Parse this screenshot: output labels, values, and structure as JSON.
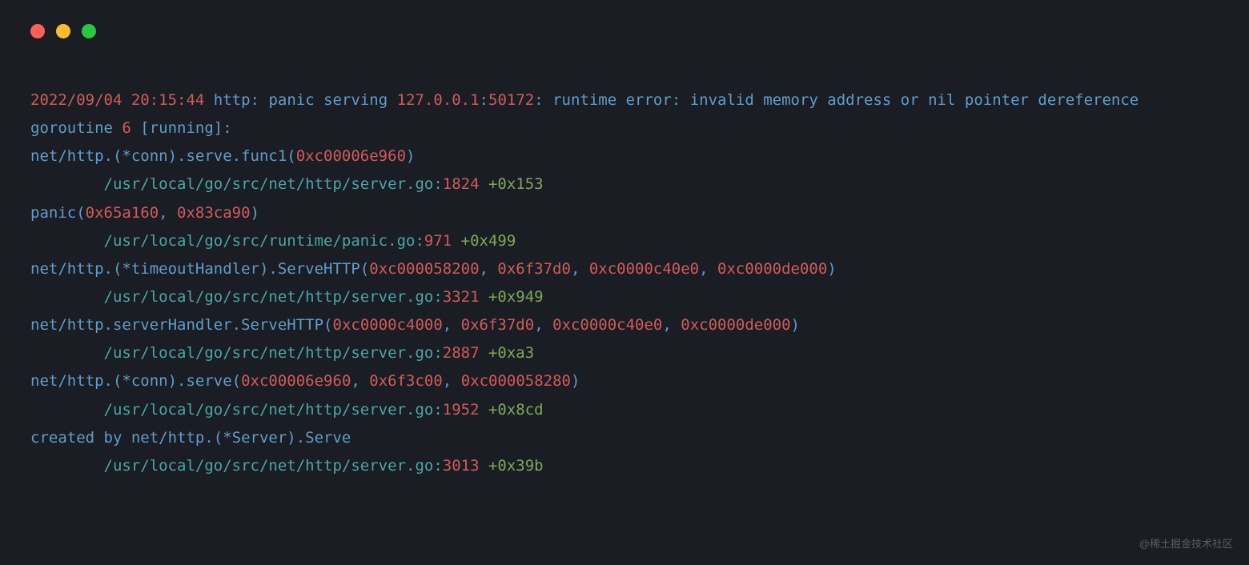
{
  "t": {
    "date": "2022/09/04 20:15:44",
    "http": " http",
    "panic_serving": " panic serving ",
    "ip": "127.0.0.1",
    "port": "50172",
    "runtime_err": " runtime error",
    "invalid": " invalid memory address or nil pointer dereference",
    "gor": "goroutine ",
    "gor_n": "6",
    "running": " [running]",
    "conn_serve_func1": "net/http.(*conn).serve.func1(",
    "hex1": "0xc00006e960",
    "server_go": "        /usr/local/go/src/net/http/server.go:",
    "ln1": "1824",
    "off1": "0x153",
    "panic_open": "panic(",
    "hex2a": "0x65a160",
    "hex2b": "0x83ca90",
    "panic_go": "        /usr/local/go/src/runtime/panic.go:",
    "ln2": "971",
    "off2": "0x499",
    "timeout": "net/http.(*timeoutHandler).ServeHTTP(",
    "hex3a": "0xc000058200",
    "hex3b": "0x6f37d0",
    "hex3c": "0xc0000c40e0",
    "hex3d": "0xc0000de000",
    "ln3": "3321",
    "off3": "0x949",
    "srvhandler": "net/http.serverHandler.ServeHTTP(",
    "hex4a": "0xc0000c4000",
    "hex4b": "0x6f37d0",
    "hex4c": "0xc0000c40e0",
    "hex4d": "0xc0000de000",
    "ln4": "2887",
    "off4": "0xa3",
    "conn_serve": "net/http.(*conn).serve(",
    "hex5a": "0xc00006e960",
    "hex5b": "0x6f3c00",
    "hex5c": "0xc000058280",
    "ln5": "1952",
    "off5": "0x8cd",
    "created": "created by net/http.(*Server).Serve",
    "ln6": "3013",
    "off6": "0x39b",
    "colon": ":",
    "comma": ", ",
    "paren": ")",
    "plus": " +"
  },
  "watermark": "@稀土掘金技术社区"
}
